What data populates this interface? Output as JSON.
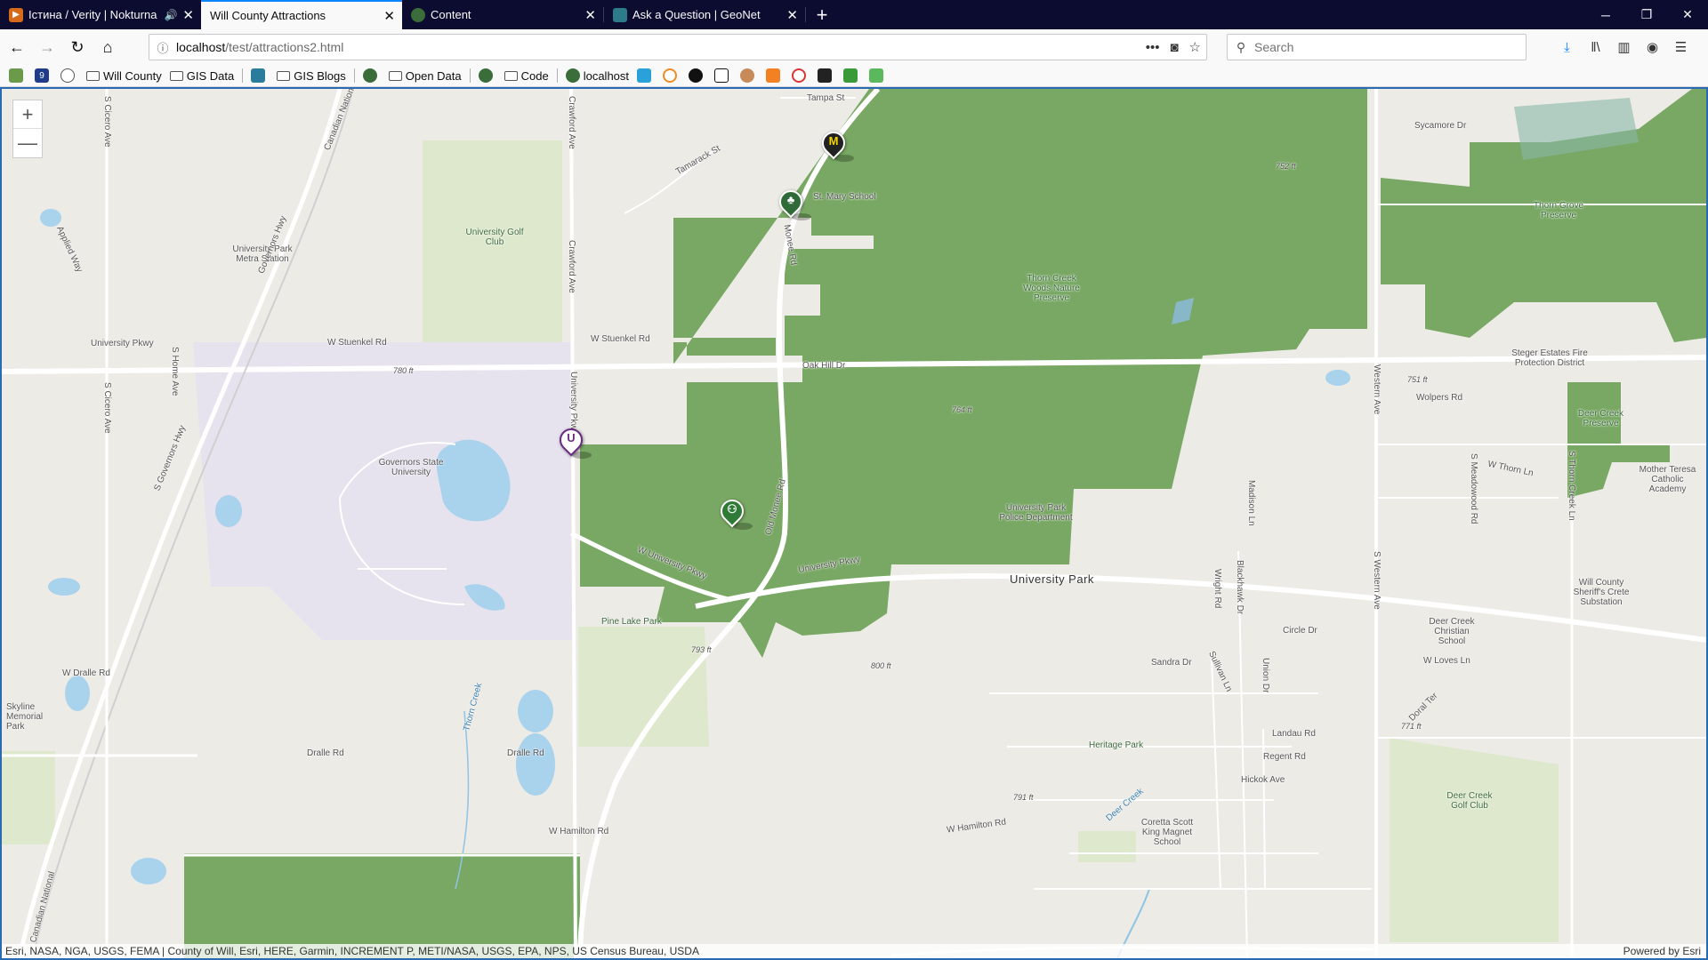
{
  "tabs": [
    {
      "title": "Істина / Verity | Nokturna",
      "favicon": "music-icon",
      "audio": true,
      "active": false
    },
    {
      "title": "Will County Attractions",
      "favicon": "",
      "audio": false,
      "active": true
    },
    {
      "title": "Content",
      "favicon": "globe-icon",
      "audio": false,
      "active": false
    },
    {
      "title": "Ask a Question | GeoNet",
      "favicon": "geonet-icon",
      "audio": false,
      "active": false
    }
  ],
  "new_tab_label": "+",
  "url": {
    "host": "localhost",
    "path": "/test/attractions2.html"
  },
  "search_placeholder": "Search",
  "bookmarks": [
    {
      "label": "",
      "icon": "arcgis-icon"
    },
    {
      "label": "",
      "icon": "nine-icon"
    },
    {
      "label": "",
      "icon": "globe-icon"
    },
    {
      "label": "Will County",
      "icon": "folder-icon"
    },
    {
      "label": "GIS Data",
      "icon": "folder-icon"
    },
    {
      "label": "",
      "icon": "map-icon"
    },
    {
      "label": "GIS Blogs",
      "icon": "folder-icon"
    },
    {
      "label": "",
      "icon": "globe-icon"
    },
    {
      "label": "Open Data",
      "icon": "folder-icon"
    },
    {
      "label": "",
      "icon": "globe-icon"
    },
    {
      "label": "Code",
      "icon": "folder-icon"
    },
    {
      "label": "localhost",
      "icon": "globe-icon"
    }
  ],
  "map": {
    "labels": {
      "tampa": "Tampa St",
      "tamarack": "Tamarack St",
      "st_mary": "St. Mary School",
      "sycamore": "Sycamore Dr",
      "thorn_grove": "Thorn Grove Preserve",
      "elev_752": "752 ft",
      "univ_golf": "University Golf Club",
      "univ_park_metra": "University Park Metra Station",
      "thorn_creek_woods": "Thorn Creek Woods Nature Preserve",
      "university_pkwy_w": "University Pkwy",
      "stuenkel_w": "W Stuenkel Rd",
      "stuenkel_e": "W Stuenkel Rd",
      "oak_hill": "Oak Hill Dr",
      "elev_780": "780 ft",
      "steger": "Steger Estates Fire Protection District",
      "elev_751": "751 ft",
      "wolpers": "Wolpers Rd",
      "elev_764": "764 ft",
      "deer_creek_preserve": "Deer Creek Preserve",
      "governors_state": "Governors State University",
      "w_thorn": "W Thorn Ln",
      "mother_teresa": "Mother Teresa Catholic Academy",
      "univ_police": "University Park Police Department",
      "w_univ_pkwy": "W University Pkwy",
      "univ_pkwy_e": "University Pkwy",
      "university_park": "University Park",
      "sheriff": "Will County Sheriff's Crete Substation",
      "pine_lake": "Pine Lake Park",
      "deer_creek_christian": "Deer Creek Christian School",
      "circle": "Circle Dr",
      "w_loves": "W Loves Ln",
      "elev_793": "793 ft",
      "elev_800": "800 ft",
      "sandra": "Sandra Dr",
      "w_dralle": "W Dralle Rd",
      "skyline": "Skyline Memorial Park",
      "doral": "Doral Ter",
      "elev_771": "771 ft",
      "landau": "Landau Rd",
      "heritage": "Heritage Park",
      "regent": "Regent Rd",
      "dralle_1": "Dralle Rd",
      "dralle_2": "Dralle Rd",
      "hickok": "Hickok Ave",
      "elev_791": "791 ft",
      "deer_creek_golf": "Deer Creek Golf Club",
      "deer_creek_stream": "Deer Creek",
      "w_hamilton_1": "W Hamilton Rd",
      "w_hamilton_2": "W Hamilton Rd",
      "coretta": "Coretta Scott King Magnet School",
      "s_cicero": "S Cicero Ave",
      "s_cicero_2": "S Cicero Ave",
      "crawford": "Crawford Ave",
      "crawford_2": "Crawford Ave",
      "univ_pkwy_vert": "University Pkwy",
      "s_home": "S Home Ave",
      "western": "Western Ave",
      "s_western": "S Western Ave",
      "madison": "Madison Ln",
      "blackhawk": "Blackhawk Dr",
      "wright": "Wright Rd",
      "union": "Union Dr",
      "sullivan": "Sullivan Ln",
      "s_meadowood": "S Meadowood Rd",
      "s_thorn_creek": "S Thorn Creek Ln",
      "governors_hwy": "Governors Hwy",
      "s_governors_hwy": "S Governors Hwy",
      "canadian_national": "Canadian National",
      "canadian_national_2": "Canadian National",
      "applied": "Applied Way",
      "old_monee": "Old Monee Rd",
      "monee": "Monee Rd",
      "thorn_creek_stream": "Thorn Creek"
    },
    "pins": [
      {
        "name": "school-pin",
        "glyph": "M",
        "color": "#222222",
        "glyph_color": "#f5d400"
      },
      {
        "name": "park-pin",
        "glyph": "♣",
        "color": "#2f6b38",
        "glyph_color": "#ffffff"
      },
      {
        "name": "university-pin",
        "glyph": "U",
        "color": "#ffffff",
        "glyph_color": "#6a2c83"
      },
      {
        "name": "recreation-pin",
        "glyph": "⚇",
        "color": "#2f7a36",
        "glyph_color": "#ffffff"
      }
    ],
    "zoom_in": "+",
    "zoom_out": "—",
    "attribution": "Esri, NASA, NGA, USGS, FEMA | County of Will, Esri, HERE, Garmin, INCREMENT P, METI/NASA, USGS, EPA, NPS, US Census Bureau, USDA",
    "powered_by": "Powered by Esri"
  },
  "colors": {
    "accent": "#0a84ff",
    "tabstrip": "#0c0c30",
    "forest": "#78a863",
    "campus": "#e7e3ee",
    "park": "#d9e5c3",
    "water": "#a9d2ec"
  }
}
